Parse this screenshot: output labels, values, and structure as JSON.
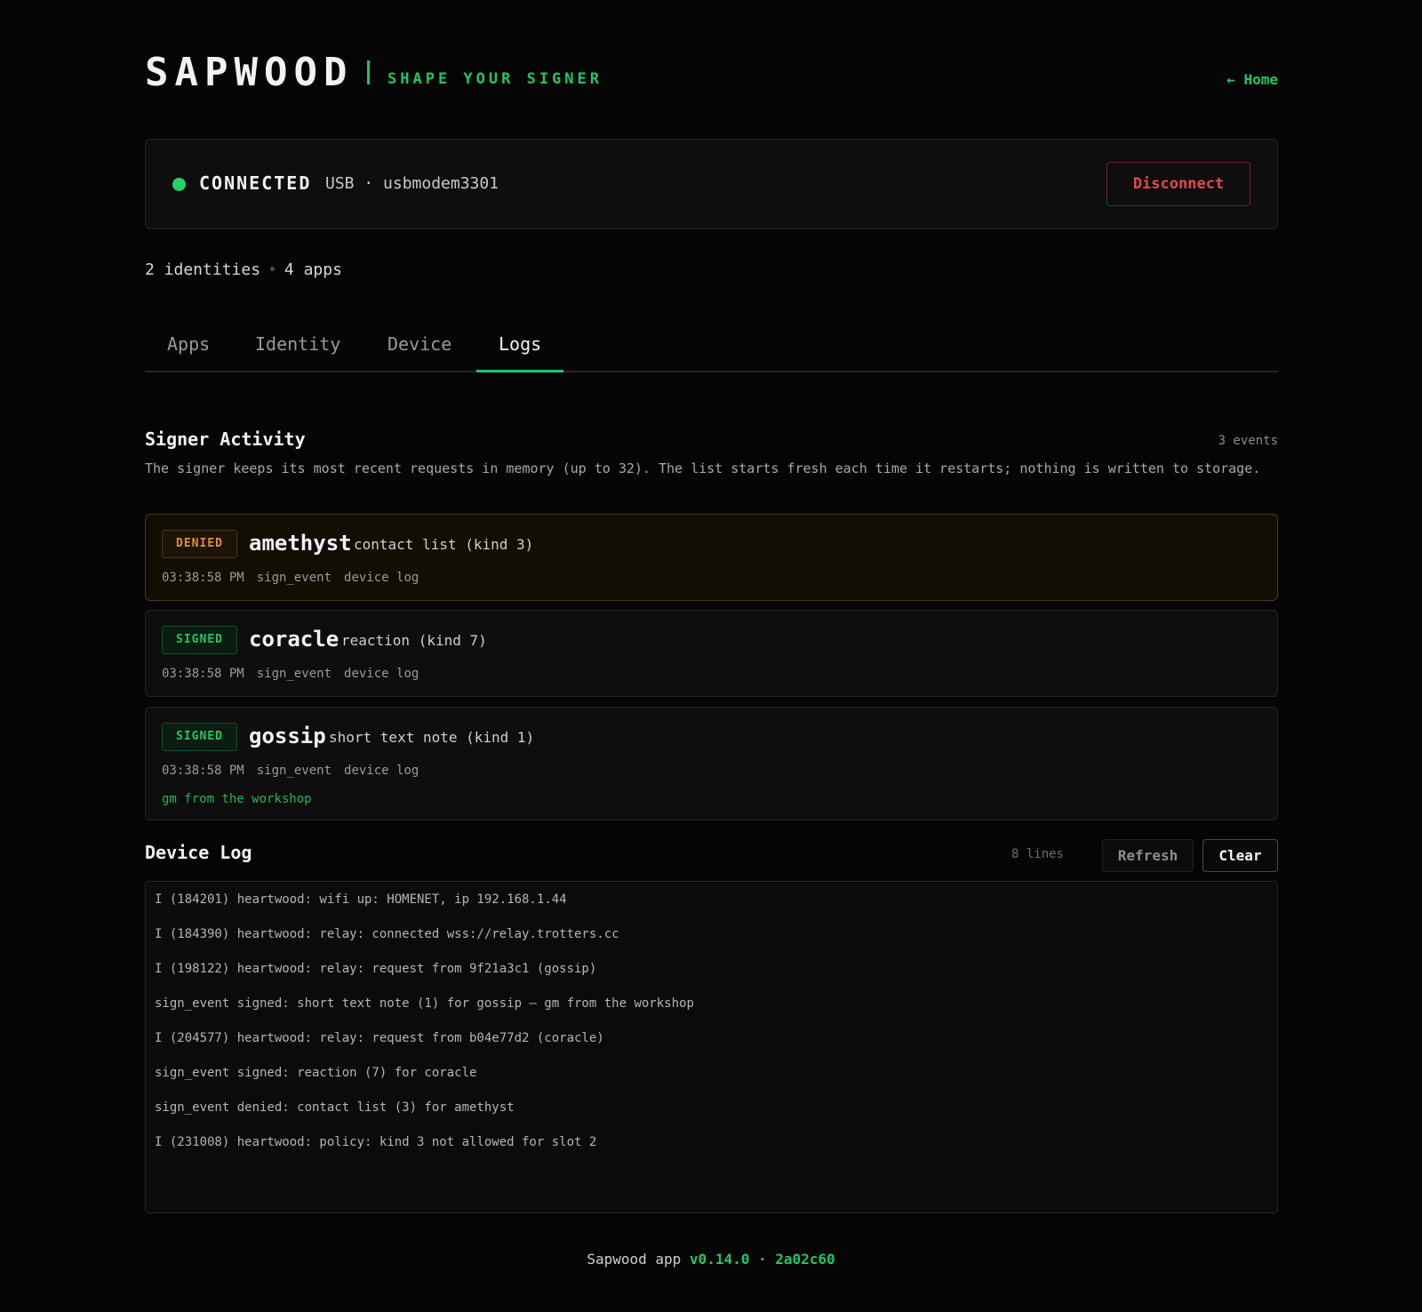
{
  "header": {
    "brand": "SAPWOOD",
    "tagline": "SHAPE YOUR SIGNER",
    "home_link": "← Home"
  },
  "connection": {
    "status": "CONNECTED",
    "detail": "USB · usbmodem3301",
    "disconnect_label": "Disconnect",
    "status_color": "#22d36a"
  },
  "summary": {
    "identities": "2 identities",
    "separator": "•",
    "apps": "4 apps"
  },
  "tabs": [
    {
      "label": "Apps",
      "active": false
    },
    {
      "label": "Identity",
      "active": false
    },
    {
      "label": "Device",
      "active": false
    },
    {
      "label": "Logs",
      "active": true
    }
  ],
  "activity": {
    "title": "Signer Activity",
    "count": "3 events",
    "description": "The signer keeps its most recent requests in memory (up to 32). The list starts fresh each time it restarts; nothing is written to storage.",
    "events": [
      {
        "status": "DENIED",
        "app": "amethyst",
        "kind": "contact list (kind 3)",
        "time": "03:38:58 PM",
        "method": "sign_event",
        "source": "device log"
      },
      {
        "status": "SIGNED",
        "app": "coracle",
        "kind": "reaction (kind 7)",
        "time": "03:38:58 PM",
        "method": "sign_event",
        "source": "device log"
      },
      {
        "status": "SIGNED",
        "app": "gossip",
        "kind": "short text note (kind 1)",
        "time": "03:38:58 PM",
        "method": "sign_event",
        "source": "device log",
        "content": "gm from the workshop"
      }
    ]
  },
  "device_log": {
    "title": "Device Log",
    "count": "8 lines",
    "refresh_label": "Refresh",
    "clear_label": "Clear",
    "lines": [
      "I (184201) heartwood: wifi up: HOMENET, ip 192.168.1.44",
      "I (184390) heartwood: relay: connected wss://relay.trotters.cc",
      "I (198122) heartwood: relay: request from 9f21a3c1 (gossip)",
      "sign_event signed: short text note (1) for gossip — gm from the workshop",
      "I (204577) heartwood: relay: request from b04e77d2 (coracle)",
      "sign_event signed: reaction (7) for coracle",
      "sign_event denied: contact list (3) for amethyst",
      "I (231008) heartwood: policy: kind 3 not allowed for slot 2"
    ]
  },
  "footer": {
    "app": "Sapwood app",
    "version": "v0.14.0 · 2a02c60"
  },
  "colors": {
    "accent": "#22c563",
    "danger": "#e5484d",
    "warning": "#e0902a",
    "background": "#050505"
  }
}
